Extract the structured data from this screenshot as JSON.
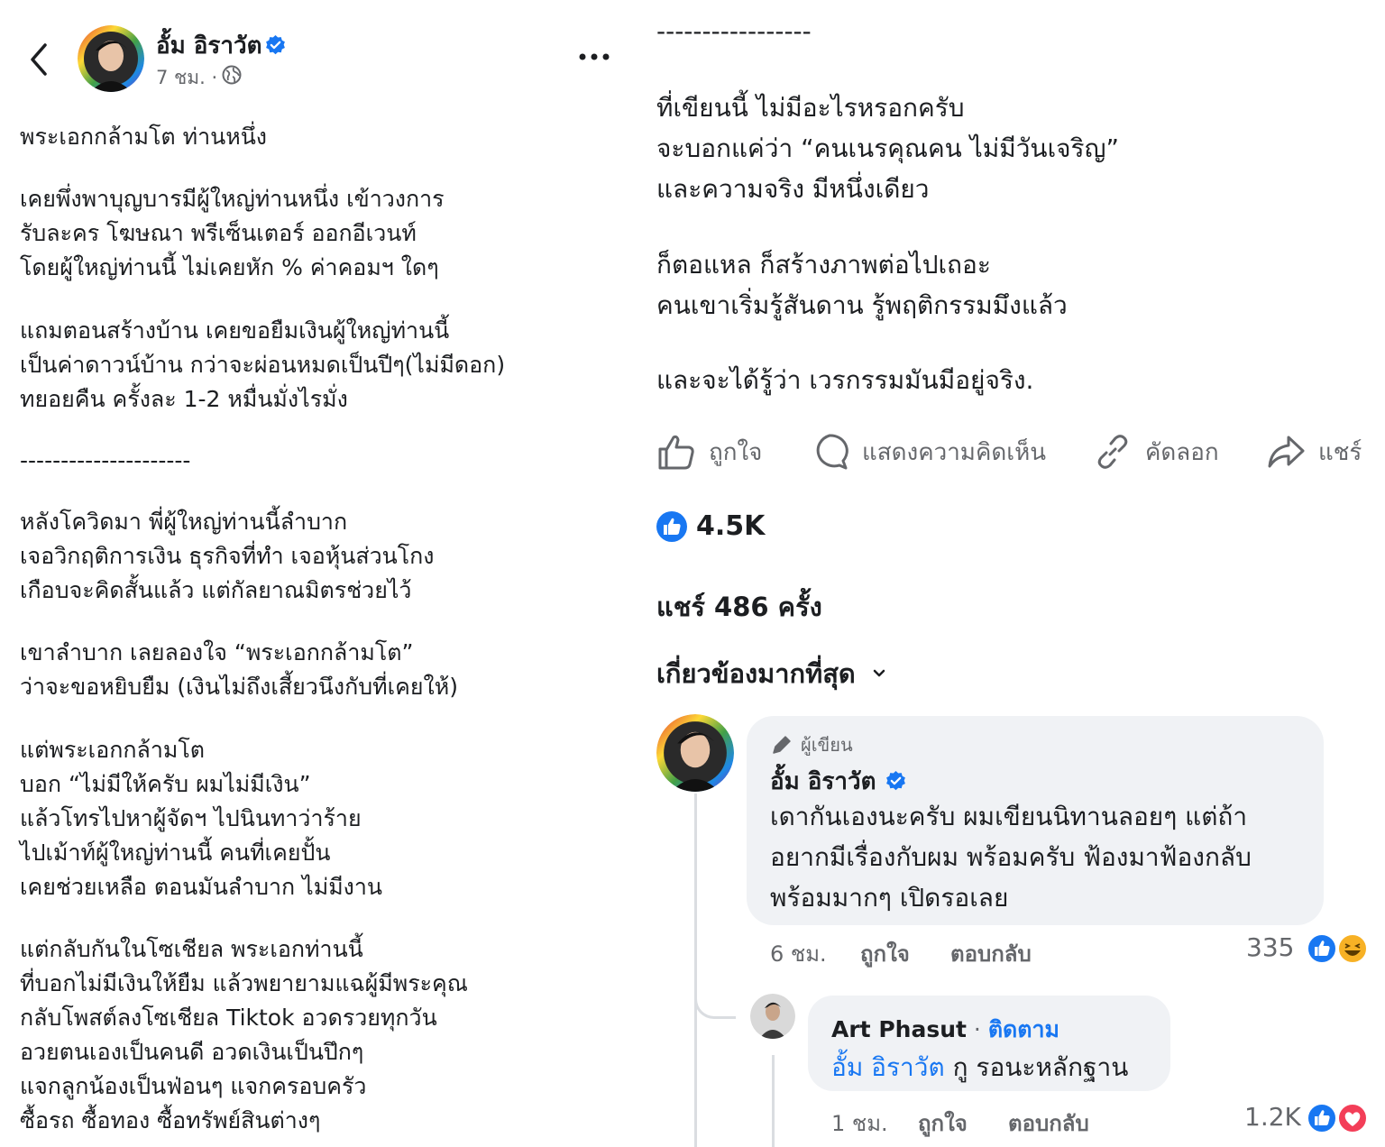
{
  "post": {
    "author": "อั้ม อิราวัต",
    "meta": "7 ชม. ·",
    "body_left": [
      "พระเอกกล้ามโต ท่านหนึ่ง",
      "เคยพึ่งพาบุญบารมีผู้ใหญ่ท่านหนึ่ง เข้าวงการ",
      "รับละคร โฆษณา พรีเซ็นเตอร์ ออกอีเวนท์",
      "โดยผู้ใหญ่ท่านนี้ ไม่เคยหัก % ค่าคอมฯ ใดๆ",
      "แถมตอนสร้างบ้าน เคยขอยืมเงินผู้ใหญ่ท่านนี้",
      "เป็นค่าดาวน์บ้าน กว่าจะผ่อนหมดเป็นปีๆ(ไม่มีดอก)",
      "ทยอยคืน ครั้งละ 1-2 หมื่นมั่งไรมั่ง",
      "---------------------",
      "หลังโควิดมา พี่ผู้ใหญ่ท่านนี้ลำบาก",
      "เจอวิกฤติการเงิน ธุรกิจที่ทำ เจอหุ้นส่วนโกง",
      "เกือบจะคิดสั้นแล้ว แต่กัลยาณมิตรช่วยไว้",
      "เขาลำบาก เลยลองใจ “พระเอกกล้ามโต”",
      "ว่าจะขอหยิบยืม (เงินไม่ถึงเสี้ยวนึงกับที่เคยให้)",
      "แต่พระเอกกล้ามโต",
      "บอก “ไม่มีให้ครับ ผมไม่มีเงิน”",
      "แล้วโทรไปหาผู้จัดฯ ไปนินทาว่าร้าย",
      "ไปเม้าท์ผู้ใหญ่ท่านนี้ คนที่เคยปั้น",
      "เคยช่วยเหลือ ตอนมันลำบาก ไม่มีงาน",
      "แต่กลับกันในโซเชียล พระเอกท่านนี้",
      "ที่บอกไม่มีเงินให้ยืม แล้วพยายามแฉผู้มีพระคุณ",
      "กลับโพสต์ลงโซเชียล Tiktok อวดรวยทุกวัน",
      "อวยตนเองเป็นคนดี อวดเงินเป็นปึกๆ",
      "แจกลูกน้องเป็นฟ่อนๆ แจกครอบครัว",
      "ซื้อรถ ซื้อทอง ซื้อทรัพย์สินต่างๆ"
    ],
    "body_right": [
      "-----------------",
      "ที่เขียนนี้ ไม่มีอะไรหรอกครับ",
      "จะบอกแค่ว่า “คนเนรคุณคน ไม่มีวันเจริญ”",
      "และความจริง มีหนึ่งเดียว",
      "ก็ตอแหล ก็สร้างภาพต่อไปเถอะ",
      "คนเขาเริ่มรู้สันดาน รู้พฤติกรรมมึงแล้ว",
      "และจะได้รู้ว่า เวรกรรมมันมีอยู่จริง."
    ]
  },
  "actions": {
    "like": "ถูกใจ",
    "comment": "แสดงความคิดเห็น",
    "copy": "คัดลอก",
    "share": "แชร์"
  },
  "stats": {
    "likes": "4.5K",
    "shares": "แชร์ 486 ครั้ง"
  },
  "sort_label": "เกี่ยวข้องมากที่สุด",
  "comments": [
    {
      "badge": "ผู้เขียน",
      "name": "อั้ม อิราวัต",
      "lines": [
        "เดากันเองนะครับ ผมเขียนนิทานลอยๆ แต่ถ้า",
        "อยากมีเรื่องกับผม พร้อมครับ ฟ้องมาฟ้องกลับ",
        "พร้อมมากๆ เปิดรอเลย"
      ],
      "time": "6 ชม.",
      "like_label": "ถูกใจ",
      "reply_label": "ตอบกลับ",
      "reaction_count": "335"
    },
    {
      "name": "Art Phasut",
      "separator": "·",
      "follow": "ติดตาม",
      "mention": "อั้ม อิราวัต",
      "text": "กู รอนะหลักฐาน",
      "time": "1 ชม.",
      "like_label": "ถูกใจ",
      "reply_label": "ตอบกลับ",
      "reaction_count": "1.2K"
    }
  ],
  "colors": {
    "accent": "#1877f2",
    "secondary_text": "#65676b",
    "bubble": "#f0f2f5",
    "love": "#f33e58",
    "haha": "#f7b125"
  }
}
